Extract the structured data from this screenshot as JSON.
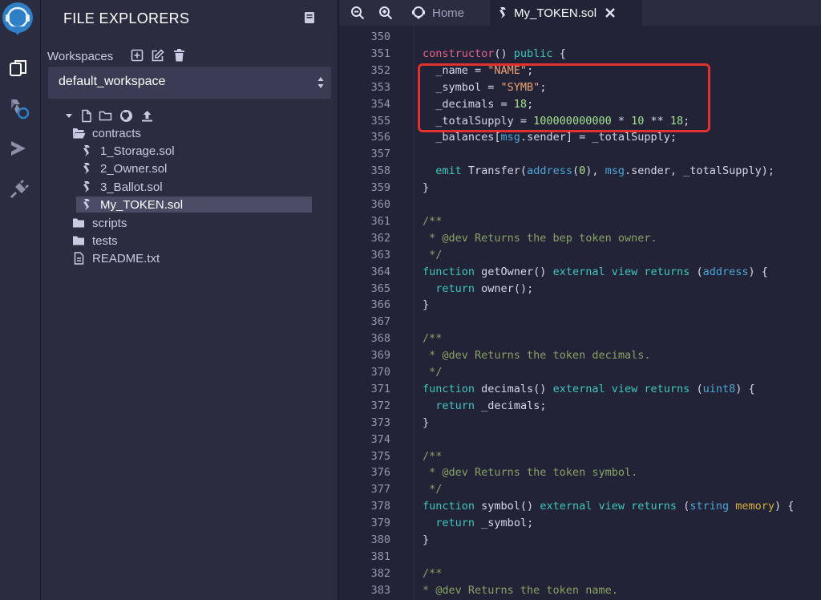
{
  "explorer": {
    "title": "FILE EXPLORERS",
    "workspaces_label": "Workspaces",
    "workspace_selected": "default_workspace"
  },
  "tree": [
    {
      "label": "contracts",
      "icon": "folder-open-icon"
    },
    {
      "label": "1_Storage.sol",
      "icon": "solidity-icon"
    },
    {
      "label": "2_Owner.sol",
      "icon": "solidity-icon"
    },
    {
      "label": "3_Ballot.sol",
      "icon": "solidity-icon"
    },
    {
      "label": "My_TOKEN.sol",
      "icon": "solidity-icon",
      "selected": true
    },
    {
      "label": "scripts",
      "icon": "folder-icon"
    },
    {
      "label": "tests",
      "icon": "folder-icon"
    },
    {
      "label": "README.txt",
      "icon": "file-text-icon"
    }
  ],
  "tabs": {
    "home": "Home",
    "active": "My_TOKEN.sol"
  },
  "editor": {
    "lines": [
      {
        "n": "350",
        "code": ""
      },
      {
        "n": "351",
        "code": "constructor() public {"
      },
      {
        "n": "352",
        "code": "  _name = \"NAME\";"
      },
      {
        "n": "353",
        "code": "  _symbol = \"SYMB\";"
      },
      {
        "n": "354",
        "code": "  _decimals = 18;"
      },
      {
        "n": "355",
        "code": "  _totalSupply = 100000000000 * 10 ** 18;"
      },
      {
        "n": "356",
        "code": "  _balances[msg.sender] = _totalSupply;"
      },
      {
        "n": "357",
        "code": ""
      },
      {
        "n": "358",
        "code": "  emit Transfer(address(0), msg.sender, _totalSupply);"
      },
      {
        "n": "359",
        "code": "}"
      },
      {
        "n": "360",
        "code": ""
      },
      {
        "n": "361",
        "code": "/**"
      },
      {
        "n": "362",
        "code": " * @dev Returns the bep token owner."
      },
      {
        "n": "363",
        "code": " */"
      },
      {
        "n": "364",
        "code": "function getOwner() external view returns (address) {"
      },
      {
        "n": "365",
        "code": "  return owner();"
      },
      {
        "n": "366",
        "code": "}"
      },
      {
        "n": "367",
        "code": ""
      },
      {
        "n": "368",
        "code": "/**"
      },
      {
        "n": "369",
        "code": " * @dev Returns the token decimals."
      },
      {
        "n": "370",
        "code": " */"
      },
      {
        "n": "371",
        "code": "function decimals() external view returns (uint8) {"
      },
      {
        "n": "372",
        "code": "  return _decimals;"
      },
      {
        "n": "373",
        "code": "}"
      },
      {
        "n": "374",
        "code": ""
      },
      {
        "n": "375",
        "code": "/**"
      },
      {
        "n": "376",
        "code": " * @dev Returns the token symbol."
      },
      {
        "n": "377",
        "code": " */"
      },
      {
        "n": "378",
        "code": "function symbol() external view returns (string memory) {"
      },
      {
        "n": "379",
        "code": "  return _symbol;"
      },
      {
        "n": "380",
        "code": "}"
      },
      {
        "n": "381",
        "code": ""
      },
      {
        "n": "382",
        "code": "/**"
      },
      {
        "n": "383",
        "code": "* @dev Returns the token name."
      }
    ]
  },
  "colors": {
    "background": "#222336",
    "panel": "#2a2c3f",
    "highlight_border": "#e0312f",
    "keyword_pink": "#e7608b",
    "keyword_teal": "#3ec7bd",
    "string": "#f0a174",
    "number": "#a5e28e",
    "comment": "#8aa264"
  }
}
